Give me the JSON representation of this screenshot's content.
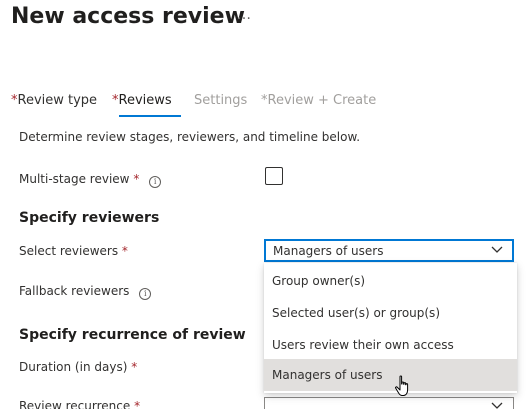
{
  "header": {
    "title": "New access review",
    "more_icon": "…"
  },
  "tabs": [
    {
      "label": "Review type",
      "required": true,
      "state": "normal"
    },
    {
      "label": "Reviews",
      "required": true,
      "state": "active"
    },
    {
      "label": "Settings",
      "required": false,
      "state": "disabled"
    },
    {
      "label": "Review + Create",
      "required": true,
      "state": "disabled"
    }
  ],
  "description": "Determine review stages, reviewers, and timeline below.",
  "multi_stage": {
    "label": "Multi-stage review",
    "required_mark": "*",
    "info_icon": "i",
    "checked": false
  },
  "specify_reviewers": {
    "heading": "Specify reviewers",
    "select_label": "Select reviewers",
    "required_mark": "*",
    "selected_value": "Managers of users",
    "fallback_label": "Fallback reviewers",
    "info_icon": "i",
    "options": [
      "Group owner(s)",
      "Selected user(s) or group(s)",
      "Users review their own access",
      "Managers of users"
    ]
  },
  "recurrence": {
    "heading": "Specify recurrence of review",
    "duration_label": "Duration (in days)",
    "recurrence_label": "Review recurrence",
    "required_mark": "*"
  },
  "colors": {
    "accent": "#0078d4",
    "required": "#a4262c",
    "disabled_text": "#a19f9d",
    "selected_option_bg": "#e1dfdd"
  }
}
